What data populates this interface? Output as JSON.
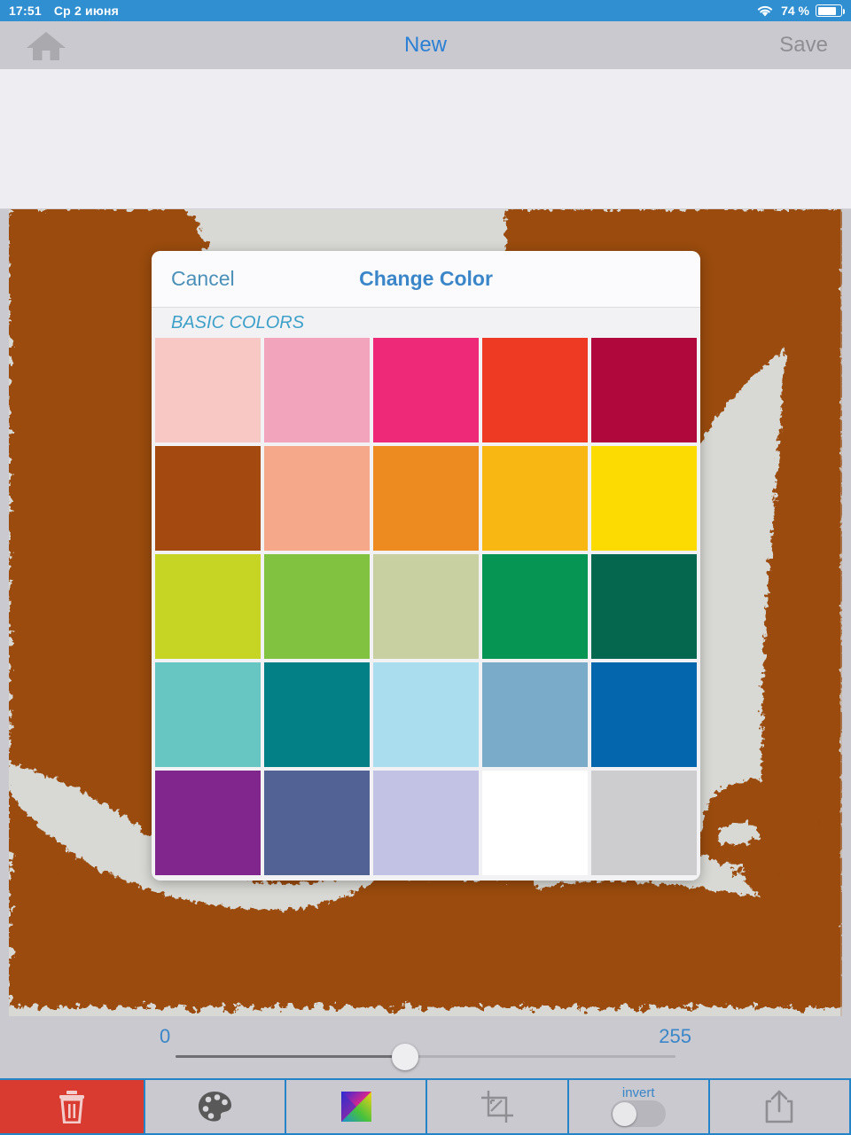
{
  "statusbar": {
    "time": "17:51",
    "date": "Ср 2 июня",
    "battery_percent": "74 %",
    "wifi_icon": "wifi-icon",
    "battery_icon": "battery-icon"
  },
  "navbar": {
    "home_icon": "home-icon",
    "title": "New",
    "save_label": "Save",
    "title_color": "#2b7fd4",
    "save_color": "#8e8e93"
  },
  "modal": {
    "cancel_label": "Cancel",
    "title": "Change Color",
    "section_label": "BASIC COLORS",
    "title_color": "#3a86c8",
    "cancel_color": "#4a90b8",
    "section_color": "#3da0c8",
    "swatches": [
      {
        "name": "light-pink",
        "hex": "#f8c9c4"
      },
      {
        "name": "pink",
        "hex": "#f2a4bd"
      },
      {
        "name": "magenta",
        "hex": "#ee2a78"
      },
      {
        "name": "red-orange",
        "hex": "#ef3a23"
      },
      {
        "name": "crimson",
        "hex": "#b0073c"
      },
      {
        "name": "brown",
        "hex": "#a44a10"
      },
      {
        "name": "salmon",
        "hex": "#f5a98a"
      },
      {
        "name": "orange",
        "hex": "#ed8a20"
      },
      {
        "name": "amber",
        "hex": "#f9b713"
      },
      {
        "name": "yellow",
        "hex": "#fcdb02"
      },
      {
        "name": "lime",
        "hex": "#c6d424"
      },
      {
        "name": "yellow-green",
        "hex": "#81c341"
      },
      {
        "name": "sage",
        "hex": "#c8d0a2"
      },
      {
        "name": "emerald",
        "hex": "#069553"
      },
      {
        "name": "dark-green",
        "hex": "#06674f"
      },
      {
        "name": "turquoise",
        "hex": "#68c6c2"
      },
      {
        "name": "teal",
        "hex": "#037f86"
      },
      {
        "name": "sky-blue",
        "hex": "#aadeee"
      },
      {
        "name": "steel-blue",
        "hex": "#7aabc9"
      },
      {
        "name": "blue",
        "hex": "#0466ad"
      },
      {
        "name": "purple",
        "hex": "#81268d"
      },
      {
        "name": "slate-blue",
        "hex": "#526295"
      },
      {
        "name": "lavender",
        "hex": "#c2c3e4"
      },
      {
        "name": "white",
        "hex": "#ffffff"
      },
      {
        "name": "light-gray",
        "hex": "#cdcdcf"
      }
    ]
  },
  "slider": {
    "min_label": "0",
    "max_label": "255",
    "value_percent": 46,
    "label_color": "#3a86c8"
  },
  "toolbar": {
    "accent_color": "#2583c8",
    "delete_color": "#d93b31",
    "buttons": [
      {
        "name": "delete-button",
        "icon": "trash-icon"
      },
      {
        "name": "palette-button",
        "icon": "palette-icon"
      },
      {
        "name": "colorwheel-button",
        "icon": "color-wheel-icon"
      },
      {
        "name": "crop-button",
        "icon": "crop-icon"
      },
      {
        "name": "invert-toggle",
        "icon": "toggle-switch-icon",
        "label": "invert",
        "state": "off"
      },
      {
        "name": "share-button",
        "icon": "share-icon"
      }
    ]
  },
  "photo": {
    "description": "duotone-portrait",
    "ink_color": "#9a4b11",
    "paper_color": "#d8d8d4"
  }
}
